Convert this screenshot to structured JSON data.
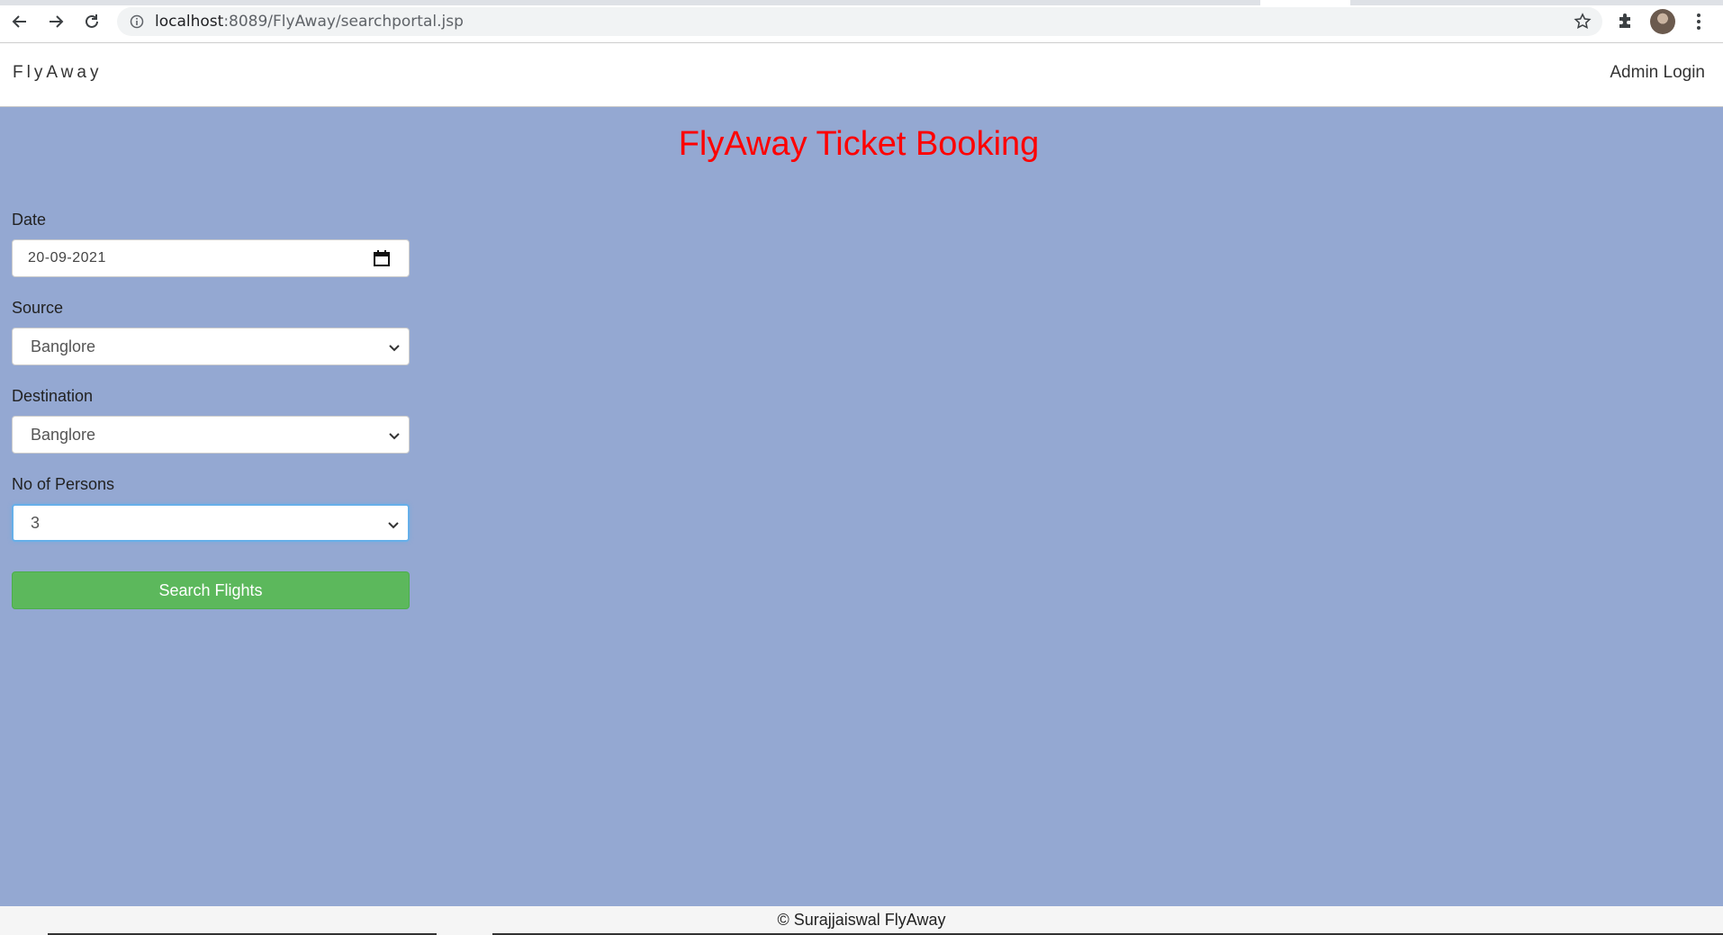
{
  "browser": {
    "url_host": "localhost",
    "url_rest": ":8089/FlyAway/searchportal.jsp"
  },
  "navbar": {
    "brand": "FlyAway",
    "admin_login": "Admin Login"
  },
  "page": {
    "title": "FlyAway Ticket Booking"
  },
  "form": {
    "date": {
      "label": "Date",
      "value": "20-09-2021"
    },
    "source": {
      "label": "Source",
      "value": "Banglore"
    },
    "destination": {
      "label": "Destination",
      "value": "Banglore"
    },
    "persons": {
      "label": "No of Persons",
      "value": "3"
    },
    "submit_label": "Search Flights"
  },
  "footer": {
    "text": "© Surajjaiswal FlyAway"
  },
  "colors": {
    "page_background": "#94a8d2",
    "title": "#ff0000",
    "search_button": "#5cb85c"
  }
}
